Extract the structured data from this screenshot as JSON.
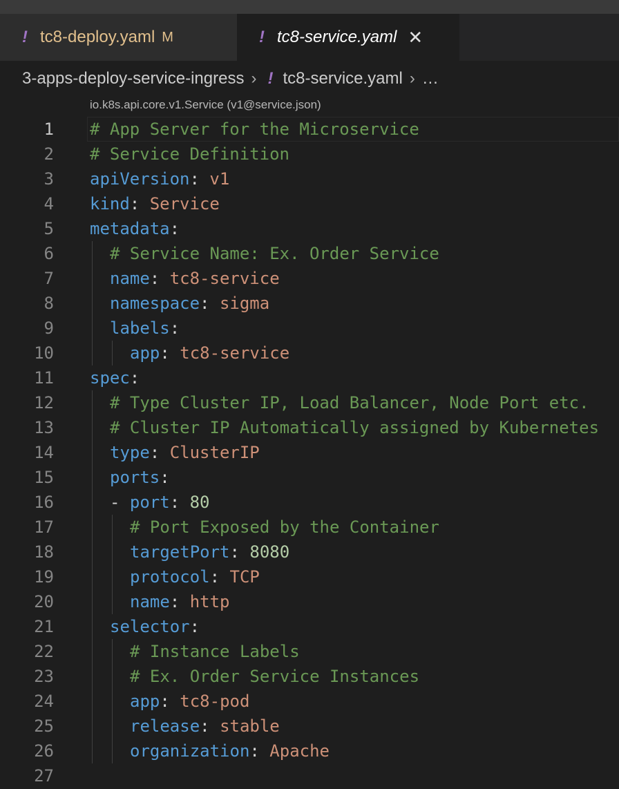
{
  "tabs": [
    {
      "label": "tc8-deploy.yaml",
      "badge": "M",
      "icon": "yaml-exclamation-icon"
    },
    {
      "label": "tc8-service.yaml",
      "icon": "yaml-exclamation-icon",
      "close": "✕"
    }
  ],
  "breadcrumb": {
    "folder": "3-apps-deploy-service-ingress",
    "file": "tc8-service.yaml",
    "more": "…",
    "sep": "›"
  },
  "schema_hint": "io.k8s.api.core.v1.Service (v1@service.json)",
  "lines": [
    {
      "n": "1",
      "indent": 0,
      "tokens": [
        [
          "c",
          "# App Server for the Microservice"
        ]
      ]
    },
    {
      "n": "2",
      "indent": 0,
      "tokens": [
        [
          "c",
          "# Service Definition"
        ]
      ]
    },
    {
      "n": "3",
      "indent": 0,
      "tokens": [
        [
          "k",
          "apiVersion"
        ],
        [
          "p",
          ": "
        ],
        [
          "s",
          "v1"
        ]
      ]
    },
    {
      "n": "4",
      "indent": 0,
      "tokens": [
        [
          "k",
          "kind"
        ],
        [
          "p",
          ": "
        ],
        [
          "s",
          "Service"
        ]
      ]
    },
    {
      "n": "5",
      "indent": 0,
      "tokens": [
        [
          "k",
          "metadata"
        ],
        [
          "p",
          ":"
        ]
      ]
    },
    {
      "n": "6",
      "indent": 1,
      "tokens": [
        [
          "c",
          "# Service Name: Ex. Order Service"
        ]
      ]
    },
    {
      "n": "7",
      "indent": 1,
      "tokens": [
        [
          "k",
          "name"
        ],
        [
          "p",
          ": "
        ],
        [
          "s",
          "tc8-service"
        ]
      ]
    },
    {
      "n": "8",
      "indent": 1,
      "tokens": [
        [
          "k",
          "namespace"
        ],
        [
          "p",
          ": "
        ],
        [
          "s",
          "sigma"
        ]
      ]
    },
    {
      "n": "9",
      "indent": 1,
      "tokens": [
        [
          "k",
          "labels"
        ],
        [
          "p",
          ":"
        ]
      ]
    },
    {
      "n": "10",
      "indent": 2,
      "tokens": [
        [
          "k",
          "app"
        ],
        [
          "p",
          ": "
        ],
        [
          "s",
          "tc8-service"
        ]
      ]
    },
    {
      "n": "11",
      "indent": 0,
      "tokens": [
        [
          "k",
          "spec"
        ],
        [
          "p",
          ":"
        ]
      ]
    },
    {
      "n": "12",
      "indent": 1,
      "tokens": [
        [
          "c",
          "# Type Cluster IP, Load Balancer, Node Port etc."
        ]
      ]
    },
    {
      "n": "13",
      "indent": 1,
      "tokens": [
        [
          "c",
          "# Cluster IP Automatically assigned by Kubernetes"
        ]
      ]
    },
    {
      "n": "14",
      "indent": 1,
      "tokens": [
        [
          "k",
          "type"
        ],
        [
          "p",
          ": "
        ],
        [
          "s",
          "ClusterIP"
        ]
      ]
    },
    {
      "n": "15",
      "indent": 1,
      "tokens": [
        [
          "k",
          "ports"
        ],
        [
          "p",
          ":"
        ]
      ]
    },
    {
      "n": "16",
      "indent": 1,
      "tokens": [
        [
          "p",
          "- "
        ],
        [
          "k",
          "port"
        ],
        [
          "p",
          ": "
        ],
        [
          "n",
          "80"
        ]
      ]
    },
    {
      "n": "17",
      "indent": 2,
      "tokens": [
        [
          "c",
          "# Port Exposed by the Container"
        ]
      ]
    },
    {
      "n": "18",
      "indent": 2,
      "tokens": [
        [
          "k",
          "targetPort"
        ],
        [
          "p",
          ": "
        ],
        [
          "n",
          "8080"
        ]
      ]
    },
    {
      "n": "19",
      "indent": 2,
      "tokens": [
        [
          "k",
          "protocol"
        ],
        [
          "p",
          ": "
        ],
        [
          "s",
          "TCP"
        ]
      ]
    },
    {
      "n": "20",
      "indent": 2,
      "tokens": [
        [
          "k",
          "name"
        ],
        [
          "p",
          ": "
        ],
        [
          "s",
          "http"
        ]
      ]
    },
    {
      "n": "21",
      "indent": 1,
      "tokens": [
        [
          "k",
          "selector"
        ],
        [
          "p",
          ":"
        ]
      ]
    },
    {
      "n": "22",
      "indent": 2,
      "tokens": [
        [
          "c",
          "# Instance Labels"
        ]
      ]
    },
    {
      "n": "23",
      "indent": 2,
      "tokens": [
        [
          "c",
          "# Ex. Order Service Instances"
        ]
      ]
    },
    {
      "n": "24",
      "indent": 2,
      "tokens": [
        [
          "k",
          "app"
        ],
        [
          "p",
          ": "
        ],
        [
          "s",
          "tc8-pod"
        ]
      ]
    },
    {
      "n": "25",
      "indent": 2,
      "tokens": [
        [
          "k",
          "release"
        ],
        [
          "p",
          ": "
        ],
        [
          "s",
          "stable"
        ]
      ]
    },
    {
      "n": "26",
      "indent": 2,
      "tokens": [
        [
          "k",
          "organization"
        ],
        [
          "p",
          ": "
        ],
        [
          "s",
          "Apache"
        ]
      ]
    },
    {
      "n": "27",
      "indent": 0,
      "tokens": []
    }
  ]
}
